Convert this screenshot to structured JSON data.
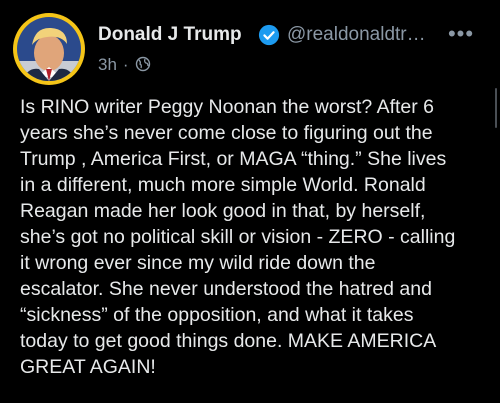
{
  "tweet": {
    "author_name": "Donald J Trump",
    "handle": "@realdonaldtr…",
    "time": "3h",
    "separator": "·",
    "verified_icon": "verified-badge-icon",
    "visibility_icon": "globe-icon",
    "more_label": "•••",
    "text": "Is RINO writer Peggy Noonan the worst? After 6\nyears she’s never come close to figuring out the\nTrump , America First, or MAGA “thing.” She lives\nin a different, much more simple World. Ronald\nReagan made her look good in that, by herself,\nshe’s got no political skill or vision - ZERO - calling\nit wrong ever since my wild ride down the\nescalator. She never understood the hatred and\n“sickness” of the opposition, and what it takes\ntoday to get good things done. MAKE AMERICA\nGREAT AGAIN!"
  },
  "colors": {
    "background": "#000000",
    "text_primary": "#e7e9ea",
    "text_secondary": "#8b98a5",
    "verified_blue": "#1d9bf0",
    "avatar_ring": "#f5c518"
  }
}
